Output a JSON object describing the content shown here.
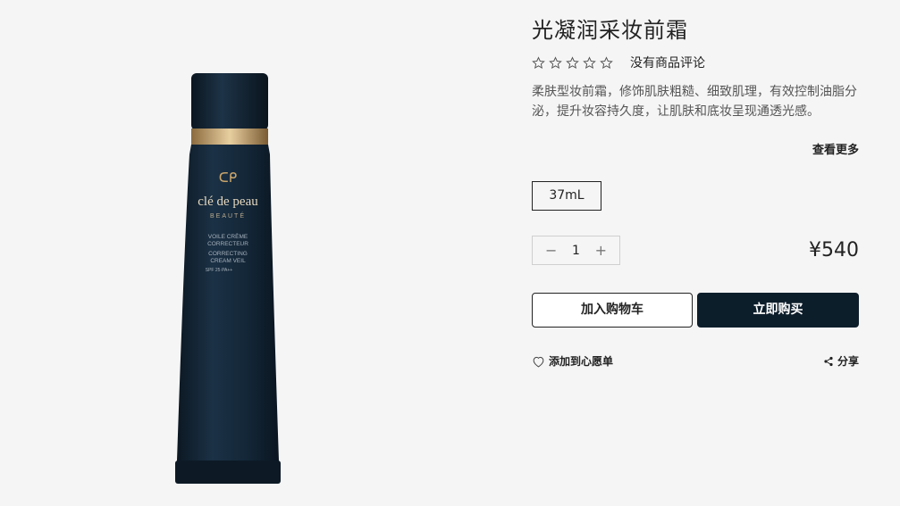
{
  "product": {
    "title": "光凝润采妆前霜",
    "rating": {
      "stars_filled": 0,
      "stars_total": 5,
      "review_text": "没有商品评论"
    },
    "description": "柔肤型妆前霜，修饰肌肤粗糙、细致肌理，有效控制油脂分泌，提升妆容持久度，让肌肤和底妆呈现通透光感。",
    "more_label": "查看更多",
    "size_option": "37mL",
    "quantity": {
      "minus": "−",
      "value": "1",
      "plus": "+"
    },
    "price": "¥540",
    "add_to_cart": "加入购物车",
    "buy_now": "立即购买",
    "wishlist_label": "添加到心愿单",
    "share_label": "分享"
  },
  "packaging": {
    "brand_mark": "ᑕᑭ",
    "brand": "clé de peau",
    "sub_brand": "BEAUTÉ",
    "line1": "VOILE CRÈME",
    "line2": "CORRECTEUR",
    "line3": "CORRECTING",
    "line4": "CREAM VEIL",
    "line5": "SPF 25·PA++"
  },
  "colors": {
    "primary_button": "#0d1e2b",
    "tube": "#16283a",
    "gold": "#c9a46a"
  }
}
